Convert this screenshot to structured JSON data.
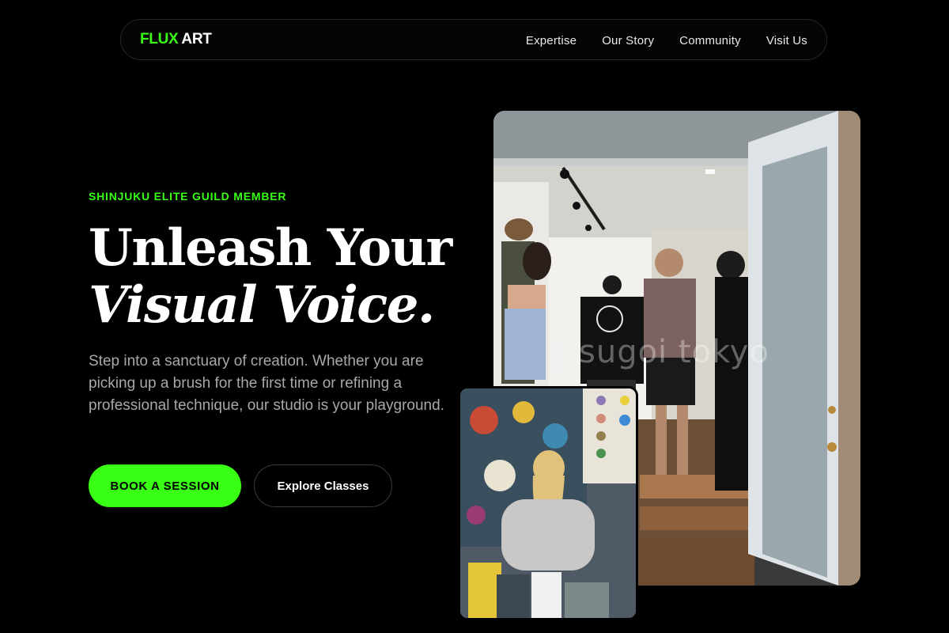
{
  "brand": {
    "part1": "FLUX",
    "part2": "ART",
    "accent_color": "#39ff14"
  },
  "nav": {
    "items": [
      {
        "label": "Expertise"
      },
      {
        "label": "Our Story"
      },
      {
        "label": "Community"
      },
      {
        "label": "Visit Us"
      }
    ]
  },
  "hero": {
    "eyebrow": "SHINJUKU ELITE GUILD MEMBER",
    "headline_line1": "Unleash Your",
    "headline_line2": "Visual Voice.",
    "lead": "Step into a sanctuary of creation. Whether you are picking up a brush for the first time or refining a professional technique, our studio is your playground.",
    "primary_cta": "BOOK A SESSION",
    "secondary_cta": "Explore Classes"
  },
  "gallery": {
    "main_photo": {
      "watermark": "sugoi tokyo"
    },
    "small_photo": {
      "watermark": ""
    }
  }
}
